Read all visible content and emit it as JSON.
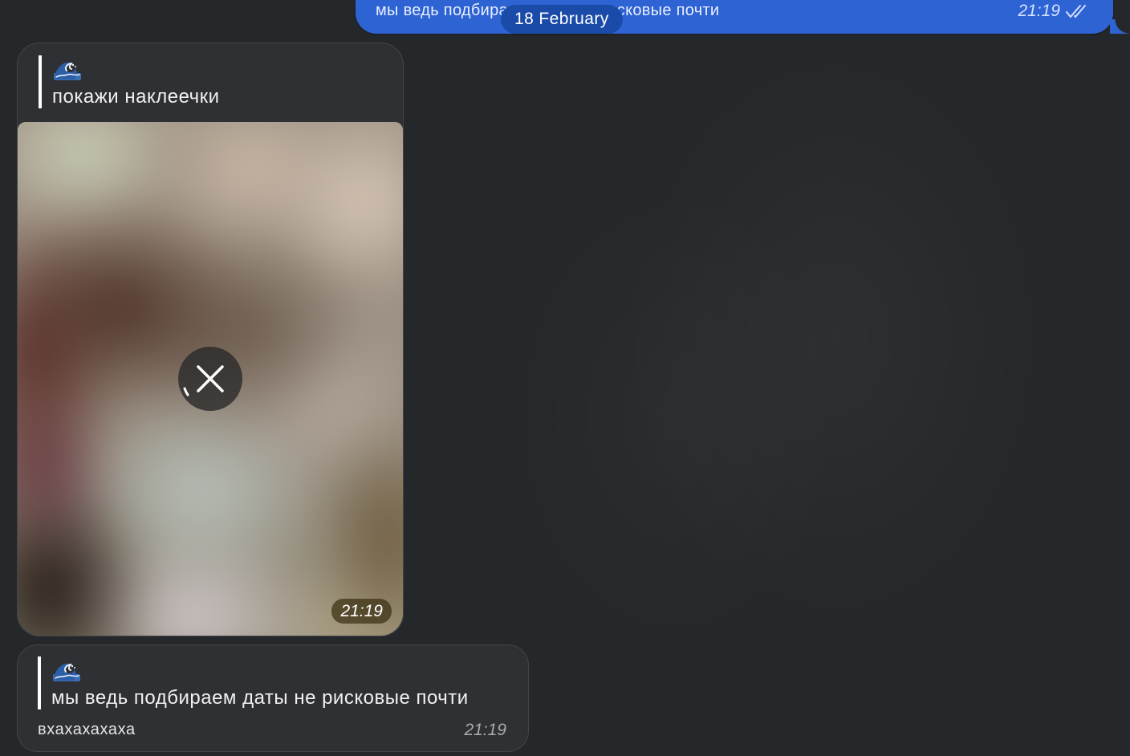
{
  "date_separator": "18 February",
  "messages": [
    {
      "direction": "outgoing",
      "text": "мы ведь подбираем даты не рисковые почти",
      "time": "21:19",
      "status_icon": "double-check-icon",
      "bubble_color": "#2e63d4"
    },
    {
      "direction": "incoming",
      "reply": {
        "author_icon": "wave-emoji-icon",
        "text": "покажи наклеечки"
      },
      "media": {
        "type": "blurred-photo",
        "overlay_icon": "cancel-download-icon"
      },
      "time": "21:19"
    },
    {
      "direction": "incoming",
      "reply": {
        "author_icon": "wave-emoji-icon",
        "text": "мы ведь подбираем даты не рисковые почти"
      },
      "text": "вхахахахаха",
      "time": "21:19"
    }
  ],
  "colors": {
    "chat_background": "#25282b",
    "incoming_bubble": "#2f3033",
    "date_pill": "#1a4ba8"
  }
}
